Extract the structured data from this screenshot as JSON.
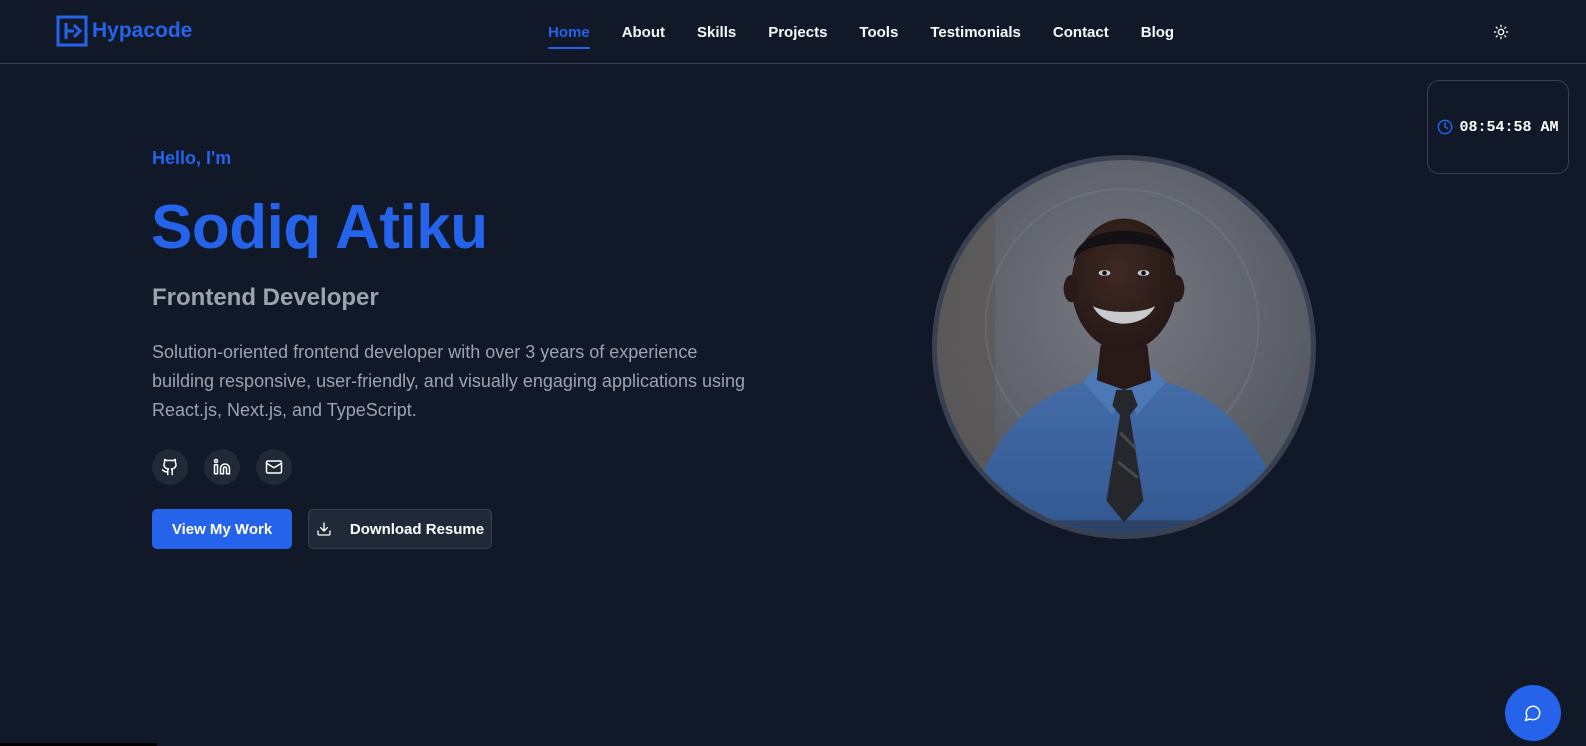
{
  "header": {
    "logo_text": "Hypacode",
    "nav": [
      {
        "label": "Home",
        "active": true
      },
      {
        "label": "About",
        "active": false
      },
      {
        "label": "Skills",
        "active": false
      },
      {
        "label": "Projects",
        "active": false
      },
      {
        "label": "Tools",
        "active": false
      },
      {
        "label": "Testimonials",
        "active": false
      },
      {
        "label": "Contact",
        "active": false
      },
      {
        "label": "Blog",
        "active": false
      }
    ],
    "theme_toggle_icon": "sun-icon"
  },
  "clock": {
    "icon": "clock-icon",
    "time": "08:54:58 AM"
  },
  "hero": {
    "greeting": "Hello, I'm",
    "name": "Sodiq Atiku",
    "role": "Frontend Developer",
    "bio": "Solution-oriented frontend developer with over 3 years of experience building responsive, user-friendly, and visually engaging applications using React.js, Next.js, and TypeScript.",
    "socials": [
      {
        "icon": "github-icon"
      },
      {
        "icon": "linkedin-icon"
      },
      {
        "icon": "mail-icon"
      }
    ],
    "primary_button": "View My Work",
    "secondary_button": "Download Resume",
    "secondary_button_icon": "download-icon"
  },
  "chat": {
    "icon": "chat-bubble-icon"
  },
  "colors": {
    "background": "#111827",
    "accent": "#2563eb",
    "muted_text": "#9ca3af",
    "surface": "#1f2937",
    "border": "#374151"
  }
}
